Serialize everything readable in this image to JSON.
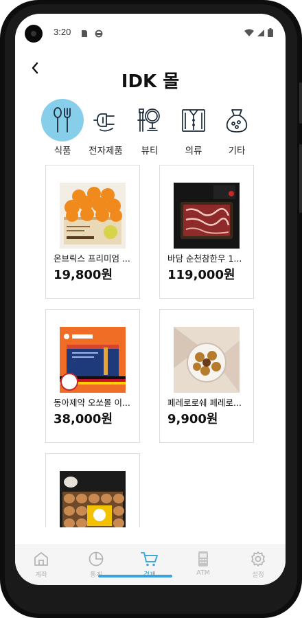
{
  "status_bar": {
    "time": "3:20"
  },
  "header": {
    "title": "IDK 몰"
  },
  "categories": [
    {
      "label": "식품",
      "icon": "utensils-icon",
      "active": true
    },
    {
      "label": "전자제품",
      "icon": "plug-icon",
      "active": false
    },
    {
      "label": "뷰티",
      "icon": "mirror-icon",
      "active": false
    },
    {
      "label": "의류",
      "icon": "shirt-icon",
      "active": false
    },
    {
      "label": "기타",
      "icon": "bag-icon",
      "active": false
    }
  ],
  "products": [
    {
      "name": "온브릭스 프리미엄 ...",
      "price": "19,800원",
      "image": "orange-box-image"
    },
    {
      "name": "바담 순천참한우 1...",
      "price": "119,000원",
      "image": "beef-tray-image"
    },
    {
      "name": "동아제약 오쏘몰 이...",
      "price": "38,000원",
      "image": "orthomol-box-image"
    },
    {
      "name": "페레로로쉐 페레로...",
      "price": "9,900원",
      "image": "chocolate-box-image"
    },
    {
      "name": "",
      "price": "",
      "image": "egg-tray-image"
    }
  ],
  "bottom_nav": [
    {
      "label": "계좌",
      "icon": "home-icon",
      "active": false
    },
    {
      "label": "통계",
      "icon": "pie-chart-icon",
      "active": false
    },
    {
      "label": "결제",
      "icon": "cart-icon",
      "active": true
    },
    {
      "label": "ATM",
      "icon": "atm-icon",
      "active": false
    },
    {
      "label": "설정",
      "icon": "gear-icon",
      "active": false
    }
  ],
  "colors": {
    "accent": "#87ceeb",
    "nav_active": "#3fa9d6",
    "nav_inactive": "#b5b5b5"
  }
}
